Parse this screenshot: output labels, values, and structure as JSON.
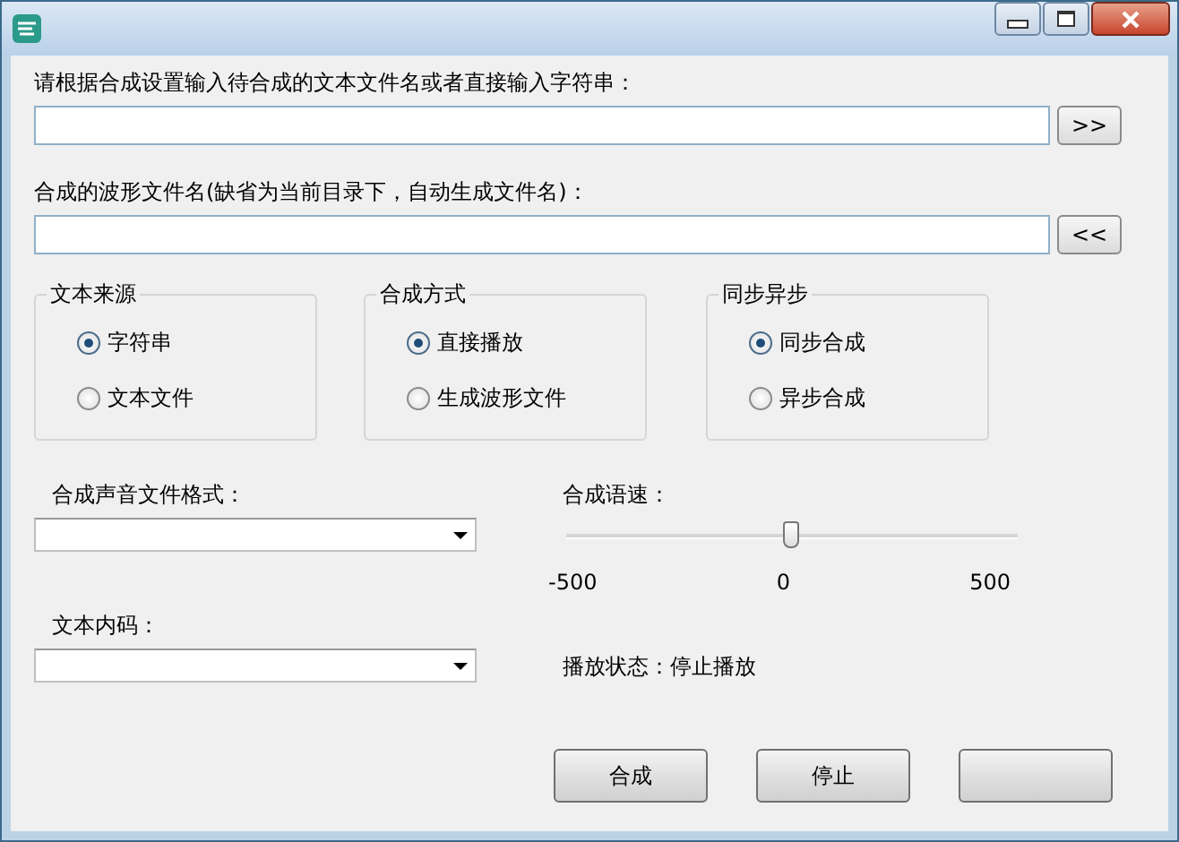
{
  "text_input": {
    "label": "请根据合成设置输入待合成的文本文件名或者直接输入字符串：",
    "button": ">>"
  },
  "wave_output": {
    "label": "合成的波形文件名(缺省为当前目录下，自动生成文件名)：",
    "button": "<<"
  },
  "groups": [
    {
      "title": "文本来源",
      "options": [
        {
          "label": "字符串",
          "selected": true
        },
        {
          "label": "文本文件",
          "selected": false
        }
      ]
    },
    {
      "title": "合成方式",
      "options": [
        {
          "label": "直接播放",
          "selected": true
        },
        {
          "label": "生成波形文件",
          "selected": false
        }
      ]
    },
    {
      "title": "同步异步",
      "options": [
        {
          "label": "同步合成",
          "selected": true
        },
        {
          "label": "异步合成",
          "selected": false
        }
      ]
    }
  ],
  "format": {
    "label": "合成声音文件格式："
  },
  "speed": {
    "label": "合成语速：",
    "level": 0.5,
    "ticks": [
      "-500",
      "0",
      "500"
    ]
  },
  "encoding": {
    "label": "文本内码："
  },
  "status": {
    "text": "播放状态：停止播放"
  },
  "buttons": [
    {
      "kind": "labeled",
      "label": "合成"
    },
    {
      "kind": "labeled",
      "label": "停止"
    },
    {
      "kind": "blank"
    }
  ]
}
